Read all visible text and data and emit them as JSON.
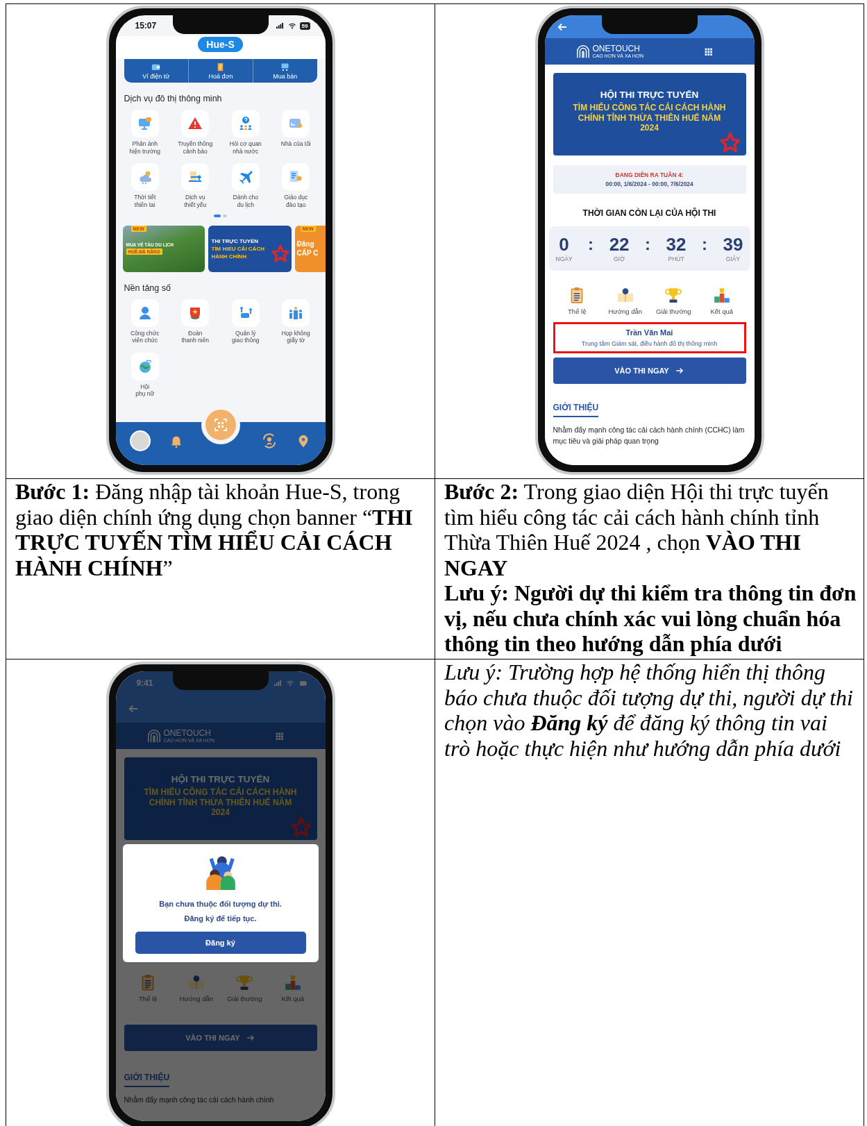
{
  "table": {
    "rows": [
      {
        "cells": [
          {
            "kind": "phone",
            "phone": {
              "kind": "home",
              "status_bar": {
                "time": "15:07",
                "battery": "59"
              },
              "logo": "Hue-S",
              "quick_actions": [
                {
                  "label": "Ví điện tử"
                },
                {
                  "label": "Hoá đơn"
                },
                {
                  "label": "Mua bán"
                }
              ],
              "blocks": [
                {
                  "kind": "services",
                  "title": "Dịch vụ đô thị thông minh",
                  "items": [
                    {
                      "label": "Phản ánh\nhiện trường"
                    },
                    {
                      "label": "Truyền thông\ncảnh báo"
                    },
                    {
                      "label": "Hỏi cơ quan\nnhà nước"
                    },
                    {
                      "label": "Nhà của tôi"
                    },
                    {
                      "label": "Thời tiết\nthiên tai"
                    },
                    {
                      "label": "Dịch vụ\nthiết yếu"
                    },
                    {
                      "label": "Dành cho\ndu lịch"
                    },
                    {
                      "label": "Giáo dục\nđào tạo"
                    }
                  ],
                  "pager": [
                    {
                      "selected": true
                    },
                    {
                      "selected": false
                    }
                  ]
                },
                {
                  "kind": "banners",
                  "items": [
                    {
                      "kind": "train",
                      "badge": "NEW",
                      "lines": [
                        "MUA VÉ TÀU DU LỊCH",
                        "HUẾ-ĐÀ NẴNG"
                      ]
                    },
                    {
                      "kind": "contest",
                      "lines": [
                        "THI TRỰC TUYẾN",
                        "TÌM HIỂU CẢI CÁCH",
                        "HÀNH CHÍNH"
                      ]
                    },
                    {
                      "kind": "promo",
                      "badge": "NEW",
                      "lines": [
                        "Đăng",
                        "CẤP C"
                      ]
                    }
                  ]
                },
                {
                  "kind": "services",
                  "title": "Nền tảng số",
                  "items": [
                    {
                      "label": "Công chức\nviên chức"
                    },
                    {
                      "label": "Đoàn\nthanh niên"
                    },
                    {
                      "label": "Quản lý\ngiao thông"
                    },
                    {
                      "label": "Họp không\ngiấy tờ"
                    },
                    {
                      "label": "Hội\nphụ nữ"
                    }
                  ]
                }
              ]
            }
          },
          {
            "kind": "phone",
            "phone": {
              "kind": "contest",
              "dimmed": false,
              "header": {
                "brand": "ONETOUCH",
                "tagline": "CAO HƠN VÀ XA HƠN"
              },
              "banner": {
                "title": "HỘI THI TRỰC TUYẾN",
                "subtitle": "TÌM HIỂU CÔNG TÁC CẢI CÁCH HÀNH CHÍNH TỈNH THỪA THIÊN HUẾ NĂM 2024"
              },
              "period": {
                "label": "ĐANG DIỄN RA TUẦN 4:",
                "range": "00:00, 1/6/2024 - 00:00, 7/6/2024"
              },
              "countdown": {
                "title": "THỜI GIAN CÒN LẠI CỦA HỘI THI",
                "separator": ":",
                "units": [
                  {
                    "value": "0",
                    "unit": "NGÀY"
                  },
                  {
                    "value": "22",
                    "unit": "GIỜ"
                  },
                  {
                    "value": "32",
                    "unit": "PHÚT"
                  },
                  {
                    "value": "39",
                    "unit": "GIÂY"
                  }
                ]
              },
              "menu": [
                {
                  "label": "Thể lệ"
                },
                {
                  "label": "Hướng dẫn"
                },
                {
                  "label": "Giải thưởng"
                },
                {
                  "label": "Kết quả"
                }
              ],
              "participant": {
                "name": "Trần Văn Mai",
                "unit": "Trung tâm Giám sát, điều hành đô thị thông minh",
                "highlighted": true
              },
              "button": {
                "label": "VÀO THI NGAY"
              },
              "intro": {
                "title": "GIỚI THIỆU",
                "text": "Nhằm đẩy mạnh công tác cải cách hành chính (CCHC) làm mục tiêu và giải pháp quan trọng"
              }
            }
          }
        ]
      },
      {
        "cells": [
          {
            "kind": "text",
            "paragraphs": [
              {
                "kind": "plain",
                "text": "**Bước 1:** Đăng nhập tài khoản Hue-S, trong giao diện chính ứng dụng chọn banner “**THI TRỰC TUYẾN TÌM HIỂU CẢI CÁCH HÀNH CHÍNH**”"
              }
            ]
          },
          {
            "kind": "text",
            "paragraphs": [
              {
                "kind": "plain",
                "text": "**Bước 2:** Trong giao diện Hội thi trực tuyến tìm hiểu công tác cải cách hành chính tỉnh Thừa Thiên Huế 2024 , chọn **VÀO THI NGAY**"
              },
              {
                "kind": "bold",
                "text": "Lưu ý: Người dự thi kiểm tra thông tin đơn vị, nếu chưa chính xác vui lòng chuẩn hóa thông tin theo hướng dẫn phía dưới"
              }
            ]
          }
        ]
      },
      {
        "cells": [
          {
            "kind": "phone",
            "phone": {
              "kind": "contest",
              "dimmed": true,
              "status_bar": {
                "time": "9:41"
              },
              "header": {
                "brand": "ONETOUCH",
                "tagline": "CAO HƠN VÀ XA HƠN"
              },
              "banner": {
                "title": "HỘI THI TRỰC TUYẾN",
                "subtitle": "TÌM HIỂU CÔNG TÁC CẢI CÁCH HÀNH CHÍNH TỈNH THỪA THIÊN HUẾ NĂM 2024"
              },
              "dialog": {
                "message": "Bạn chưa thuộc đối tượng dự thi.\nĐăng ký để tiếp tục.",
                "button": "Đăng ký"
              },
              "menu": [
                {
                  "label": "Thể lệ"
                },
                {
                  "label": "Hướng dẫn"
                },
                {
                  "label": "Giải thưởng"
                },
                {
                  "label": "Kết quả"
                }
              ],
              "button": {
                "label": "VÀO THI NGAY"
              },
              "intro": {
                "title": "GIỚI THIỆU",
                "text": "Nhằm đẩy mạnh công tác cải cách hành chính"
              }
            }
          },
          {
            "kind": "text",
            "paragraphs": [
              {
                "kind": "italic",
                "text": "Lưu ý: Trường hợp hệ thống hiển thị thông báo chưa thuộc đối tượng dự thi, người dự thi chọn vào **Đăng ký** để đăng ký thông tin vai trò hoặc thực hiện như hướng dẫn phía dưới"
              }
            ]
          }
        ]
      }
    ]
  }
}
